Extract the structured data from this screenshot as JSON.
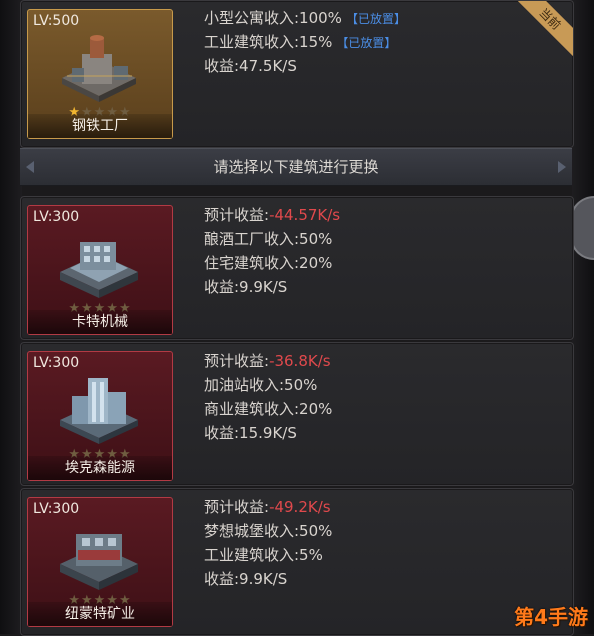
{
  "current": {
    "level": "LV:500",
    "name": "钢铁工厂",
    "stars_filled": 1,
    "stars_total": 5,
    "ribbon": "当前",
    "lines": [
      {
        "text": "小型公寓收入:100%",
        "tag": "【已放置】"
      },
      {
        "text": "工业建筑收入:15%",
        "tag": "【已放置】"
      },
      {
        "text": "收益:47.5K/S",
        "tag": ""
      }
    ]
  },
  "divider_text": "请选择以下建筑进行更换",
  "options": [
    {
      "level": "LV:300",
      "name": "卡特机械",
      "stars_filled": 0,
      "stars_total": 5,
      "forecast_label": "预计收益:",
      "forecast_value": "-44.57K/s",
      "line2": "酿酒工厂收入:50%",
      "line3": "住宅建筑收入:20%",
      "line4": "收益:9.9K/S"
    },
    {
      "level": "LV:300",
      "name": "埃克森能源",
      "stars_filled": 0,
      "stars_total": 5,
      "forecast_label": "预计收益:",
      "forecast_value": "-36.8K/s",
      "line2": "加油站收入:50%",
      "line3": "商业建筑收入:20%",
      "line4": "收益:15.9K/S"
    },
    {
      "level": "LV:300",
      "name": "纽蒙特矿业",
      "stars_filled": 0,
      "stars_total": 5,
      "forecast_label": "预计收益:",
      "forecast_value": "-49.2K/s",
      "line2": "梦想城堡收入:50%",
      "line3": "工业建筑收入:5%",
      "line4": "收益:9.9K/S"
    }
  ],
  "watermark": "第4手游",
  "colors": {
    "negative": "#e0494c",
    "placed_tag": "#4b8ee6",
    "star_on": "#f0b531",
    "star_off": "#6f5d40"
  }
}
